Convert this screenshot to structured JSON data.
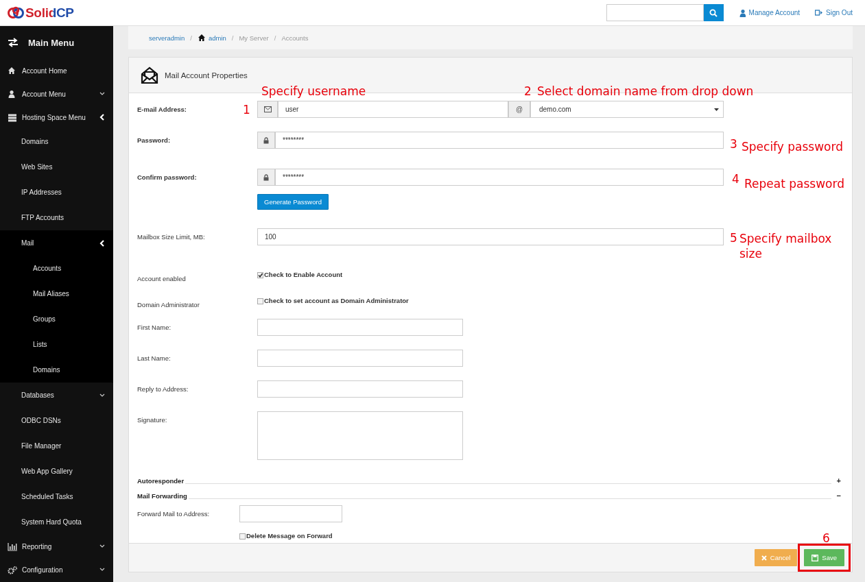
{
  "header": {
    "logo": "SolidCP",
    "links": [
      {
        "label": "Manage Account"
      },
      {
        "label": "Sign Out"
      }
    ]
  },
  "sidebar": {
    "title": "Main Menu",
    "items": [
      {
        "label": "Account Home"
      },
      {
        "label": "Account Menu",
        "expanded": false
      },
      {
        "label": "Hosting Space Menu",
        "expanded": true,
        "children": [
          {
            "label": "Domains"
          },
          {
            "label": "Web Sites"
          },
          {
            "label": "IP Addresses"
          },
          {
            "label": "FTP Accounts"
          },
          {
            "label": "Mail",
            "expanded": true,
            "children": [
              {
                "label": "Accounts"
              },
              {
                "label": "Mail Aliases"
              },
              {
                "label": "Groups"
              },
              {
                "label": "Lists"
              },
              {
                "label": "Domains"
              }
            ]
          },
          {
            "label": "Databases",
            "expanded": false
          },
          {
            "label": "ODBC DSNs"
          },
          {
            "label": "File Manager"
          },
          {
            "label": "Web App Gallery"
          },
          {
            "label": "Scheduled Tasks"
          },
          {
            "label": "System Hard Quota"
          }
        ]
      },
      {
        "label": "Reporting",
        "expanded": false
      },
      {
        "label": "Configuration",
        "expanded": false
      }
    ]
  },
  "breadcrumb": [
    {
      "label": "serveradmin",
      "link": true
    },
    {
      "separator": "/",
      "label": "admin",
      "link": true
    },
    {
      "separator": "/",
      "label": "My Server",
      "link": false
    },
    {
      "separator": "/",
      "label": "Accounts",
      "link": false
    }
  ],
  "panel": {
    "title": "Mail Account Properties",
    "fields": [
      {
        "kind": "email",
        "label": "E-mail Address:",
        "value": "user",
        "separator": "@",
        "domain": "demo.com"
      },
      {
        "kind": "password",
        "label": "Password:",
        "value": "********"
      },
      {
        "kind": "password",
        "label": "Confirm password:",
        "value": "********",
        "button": "Generate Password"
      },
      {
        "kind": "text",
        "label": "Mailbox Size Limit, MB:",
        "value": "100",
        "wide": true
      },
      {
        "kind": "checkbox",
        "label": "Account enabled",
        "text": "Check to Enable Account",
        "checked": true
      },
      {
        "kind": "checkbox",
        "label": "Domain Administrator",
        "text": "Check to set account as Domain Administrator",
        "checked": false
      },
      {
        "kind": "text",
        "label": "First Name:",
        "wide": false
      },
      {
        "kind": "text",
        "label": "Last Name:",
        "wide": false
      },
      {
        "kind": "text",
        "label": "Reply to Address:",
        "wide": false
      },
      {
        "kind": "textarea",
        "label": "Signature:"
      }
    ],
    "sections": [
      {
        "title": "Autoresponder",
        "toggle": "+"
      },
      {
        "title": "Mail Forwarding",
        "toggle": "−",
        "fields": [
          {
            "kind": "text",
            "label": "Forward Mail to Address:"
          },
          {
            "kind": "checkbox",
            "text": "Delete Message on Forward",
            "checked": false
          }
        ]
      }
    ],
    "buttons": [
      {
        "kind": "cancel",
        "label": "Cancel",
        "highlighted": false
      },
      {
        "kind": "save",
        "label": "Save",
        "highlighted": true
      }
    ]
  },
  "annotations": [
    {
      "number": "1",
      "text": "Specify username"
    },
    {
      "number": "2",
      "text": "Select domain name from drop down"
    },
    {
      "number": "3",
      "text": "Specify password"
    },
    {
      "number": "4",
      "text": "Repeat password"
    },
    {
      "number": "5",
      "text": "Specify mailbox size"
    },
    {
      "number": "6"
    }
  ]
}
